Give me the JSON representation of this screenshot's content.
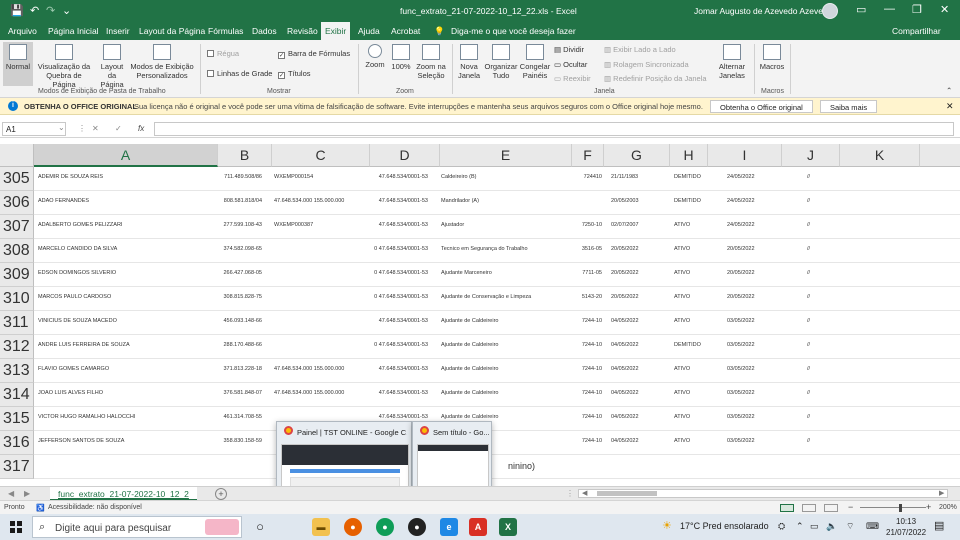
{
  "window": {
    "title": "func_extrato_21-07-2022-10_12_22.xls  -  Excel",
    "user": "Jomar Augusto de Azevedo Azevedo",
    "controls": [
      "▭",
      "—",
      "❐",
      "✕"
    ]
  },
  "quick_access": {
    "save": "💾",
    "undo": "↶",
    "redo": "↷",
    "more": "⌄"
  },
  "menu": {
    "items": [
      "Arquivo",
      "Página Inicial",
      "Inserir",
      "Layout da Página",
      "Fórmulas",
      "Dados",
      "Revisão",
      "Exibir",
      "Ajuda",
      "Acrobat"
    ],
    "active_index": 7,
    "tell_me": "Diga-me o que você deseja fazer",
    "share": "Compartilhar"
  },
  "ribbon": {
    "workbook_views": {
      "normal": "Normal",
      "page_break": "Visualização da Quebra de Página",
      "layout": "Layout da Página",
      "custom": "Modos de Exibição Personalizados",
      "group": "Modos de Exibição de Pasta de Trabalho"
    },
    "show": {
      "ruler": "Régua",
      "formula_bar": "Barra de Fórmulas",
      "gridlines": "Linhas de Grade",
      "headings": "Títulos",
      "group": "Mostrar"
    },
    "zoom": {
      "zoom": "Zoom",
      "hundred": "100%",
      "selection": "Zoom na Seleção",
      "group": "Zoom"
    },
    "window": {
      "new": "Nova Janela",
      "arrange": "Organizar Tudo",
      "freeze": "Congelar Painéis",
      "split": "Dividir",
      "hide": "Ocultar",
      "unhide": "Reexibir",
      "side_by_side": "Exibir Lado a Lado",
      "sync_scroll": "Rolagem Sincronizada",
      "reset_pos": "Redefinir Posição da Janela",
      "switch": "Alternar Janelas",
      "group": "Janela"
    },
    "macros": {
      "label": "Macros",
      "group": "Macros"
    }
  },
  "message_bar": {
    "title": "OBTENHA O OFFICE ORIGINAL",
    "text": "Sua licença não é original e você pode ser uma vítima de falsificação de software. Evite interrupções e mantenha seus arquivos seguros com o Office original hoje mesmo.",
    "button_primary": "Obtenha o Office original",
    "button_secondary": "Saiba mais"
  },
  "formula_bar": {
    "name_box": "A1",
    "cancel": "✕",
    "enter": "✓",
    "fx": "fx",
    "value": ""
  },
  "columns": [
    "A",
    "B",
    "C",
    "D",
    "E",
    "F",
    "G",
    "H",
    "I",
    "J",
    "K"
  ],
  "rows": [
    {
      "num": "305",
      "a": "ADEMIR DE SOUZA REIS",
      "b": "711.489.508/86",
      "c": "WXEMP000154",
      "d": "47.648.534/0001-53",
      "e": "Caldeireiro (B)",
      "f": "724410",
      "g": "21/11/1983",
      "h": "DEMITIDO",
      "i": "24/05/2022",
      "j": "//"
    },
    {
      "num": "306",
      "a": "ADAO FERNANDES",
      "b": "808.581.818/04",
      "c": "47.648.534.000 155.000.000",
      "d": "47.648.534/0001-53",
      "e": "Mandrilador (A)",
      "f": "",
      "g": "20/05/2003",
      "h": "DEMITIDO",
      "i": "24/05/2022",
      "j": "//"
    },
    {
      "num": "307",
      "a": "ADALBERTO GOMES PELIZZARI",
      "b": "277.599.108-43",
      "c": "WXEMP000387",
      "d": "47.648.534/0001-53",
      "e": "Ajustador",
      "f": "7250-10",
      "g": "02/07/2007",
      "h": "ATIVO",
      "i": "24/05/2022",
      "j": "//"
    },
    {
      "num": "308",
      "a": "MARCELO CANDIDO DA SILVA",
      "b": "374.582.098-65",
      "c": "",
      "d": "0  47.648.534/0001-53",
      "e": "Tecnico em Segurança do Trabalho",
      "f": "3516-05",
      "g": "20/05/2022",
      "h": "ATIVO",
      "i": "20/05/2022",
      "j": "//"
    },
    {
      "num": "309",
      "a": "EDSON DOMINGOS SILVERIO",
      "b": "266.427.068-05",
      "c": "",
      "d": "0  47.648.534/0001-53",
      "e": "Ajudante Marceneiro",
      "f": "7711-05",
      "g": "20/05/2022",
      "h": "ATIVO",
      "i": "20/05/2022",
      "j": "//"
    },
    {
      "num": "310",
      "a": "MARCOS PAULO CARDOSO",
      "b": "308.815.828-75",
      "c": "",
      "d": "0  47.648.534/0001-53",
      "e": "Ajudante de Conservação e Limpeza",
      "f": "5143-20",
      "g": "20/05/2022",
      "h": "ATIVO",
      "i": "20/05/2022",
      "j": "//"
    },
    {
      "num": "311",
      "a": "VINICIUS DE SOUZA MACEDO",
      "b": "456.093.148-66",
      "c": "",
      "d": "47.648.534/0001-53",
      "e": "Ajudante de Caldeireiro",
      "f": "7244-10",
      "g": "04/05/2022",
      "h": "ATIVO",
      "i": "03/05/2022",
      "j": "//"
    },
    {
      "num": "312",
      "a": "ANDRE LUIS FERREIRA DE SOUZA",
      "b": "288.170.488-66",
      "c": "",
      "d": "0  47.648.534/0001-53",
      "e": "Ajudante de Caldeireiro",
      "f": "7244-10",
      "g": "04/05/2022",
      "h": "DEMITIDO",
      "i": "03/05/2022",
      "j": "//"
    },
    {
      "num": "313",
      "a": "FLAVIO GOMES CAMARGO",
      "b": "371.813.228-18",
      "c": "47.648.534.000 155.000.000",
      "d": "47.648.534/0001-53",
      "e": "Ajudante de Caldeireiro",
      "f": "7244-10",
      "g": "04/05/2022",
      "h": "ATIVO",
      "i": "03/05/2022",
      "j": "//"
    },
    {
      "num": "314",
      "a": "JOAO LUIS ALVES FILHO",
      "b": "376.581.848-07",
      "c": "47.648.534.000 155.000.000",
      "d": "47.648.534/0001-53",
      "e": "Ajudante de Caldeireiro",
      "f": "7244-10",
      "g": "04/05/2022",
      "h": "ATIVO",
      "i": "03/05/2022",
      "j": "//"
    },
    {
      "num": "315",
      "a": "VICTOR HUGO RAMALHO HALOCCHI",
      "b": "461.314.708-55",
      "c": "",
      "d": "47.648.534/0001-53",
      "e": "Ajudante de Caldeireiro",
      "f": "7244-10",
      "g": "04/05/2022",
      "h": "ATIVO",
      "i": "03/05/2022",
      "j": "//"
    },
    {
      "num": "316",
      "a": "JEFFERSON SANTOS DE SOUZA",
      "b": "358.830.158-59",
      "c": "",
      "d": "",
      "e": "",
      "f": "7244-10",
      "g": "04/05/2022",
      "h": "ATIVO",
      "i": "03/05/2022",
      "j": "//"
    },
    {
      "num": "317",
      "a": "",
      "b": "",
      "c": "",
      "d": "",
      "e": "ninino)",
      "f": "",
      "g": "",
      "h": "",
      "i": "",
      "j": ""
    }
  ],
  "sheet_tabs": {
    "active": "func_extrato_21-07-2022-10_12_2",
    "add": "+",
    "prev": "◀",
    "next": "▶"
  },
  "status": {
    "mode": "Pronto",
    "accessibility": "Acessibilidade: não disponível",
    "zoom": "200%"
  },
  "previews": [
    {
      "title": "Painel | TST ONLINE - Google C..."
    },
    {
      "title": "Sem título - Go..."
    }
  ],
  "taskbar": {
    "search_placeholder": "Digite aqui para pesquisar",
    "weather": "17°C  Pred ensolarado",
    "time": "10:13",
    "date": "21/07/2022"
  }
}
